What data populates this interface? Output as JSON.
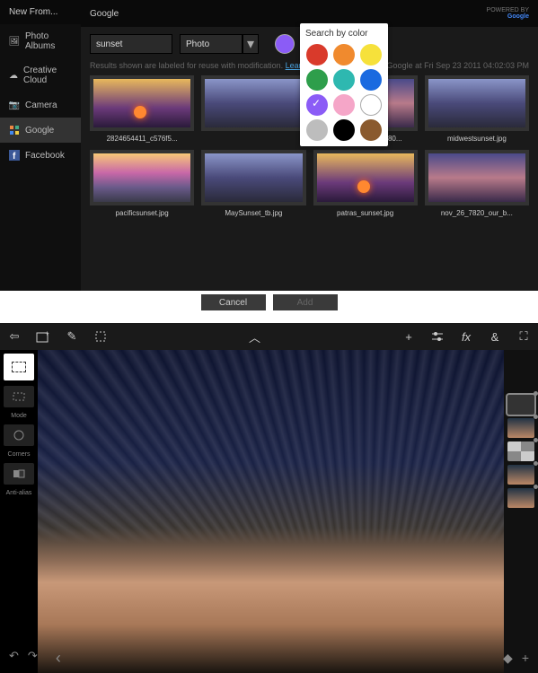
{
  "topApp": {
    "sidebar": {
      "header": "New From...",
      "items": [
        {
          "label": "Photo Albums",
          "icon": "photos"
        },
        {
          "label": "Creative Cloud",
          "icon": "cloud"
        },
        {
          "label": "Camera",
          "icon": "camera"
        },
        {
          "label": "Google",
          "icon": "google",
          "active": true
        },
        {
          "label": "Facebook",
          "icon": "fb"
        }
      ]
    },
    "title": "Google",
    "poweredBy": "POWERED BY",
    "poweredName": "Google",
    "search": {
      "query": "sunset",
      "type": "Photo"
    },
    "colorSearchSelected": "#8b5cf6",
    "info": {
      "text": "Results shown are labeled for reuse with modification. ",
      "link": "Learn More",
      "meta": "Clipped from Google at Fri Sep 23 2011 04:02:03 PM"
    },
    "colorPopup": {
      "title": "Search by color",
      "colors": [
        {
          "hex": "#d93a2b"
        },
        {
          "hex": "#f08a2e"
        },
        {
          "hex": "#f6e13b"
        },
        {
          "hex": "#2e9e4b"
        },
        {
          "hex": "#2eb8b0"
        },
        {
          "hex": "#1a6ae0"
        },
        {
          "hex": "#8b5cf6",
          "selected": true
        },
        {
          "hex": "#f5a6c8"
        },
        {
          "hex": "#ffffff",
          "outline": true
        },
        {
          "hex": "#bdbdbd"
        },
        {
          "hex": "#000000"
        },
        {
          "hex": "#8a5a2e"
        }
      ]
    },
    "thumbs": [
      {
        "label": "2824654411_c576f5..."
      },
      {
        "label": ""
      },
      {
        "label": "MaySunset_1280x80..."
      },
      {
        "label": "midwestsunset.jpg"
      },
      {
        "label": "pacificsunset.jpg"
      },
      {
        "label": "MaySunset_tb.jpg"
      },
      {
        "label": "patras_sunset.jpg"
      },
      {
        "label": "nov_26_7820_our_b..."
      }
    ],
    "buttons": {
      "cancel": "Cancel",
      "add": "Add"
    }
  },
  "bottomApp": {
    "leftTools": {
      "mode": "Mode",
      "corners": "Corners",
      "antialias": "Anti-alias"
    }
  }
}
